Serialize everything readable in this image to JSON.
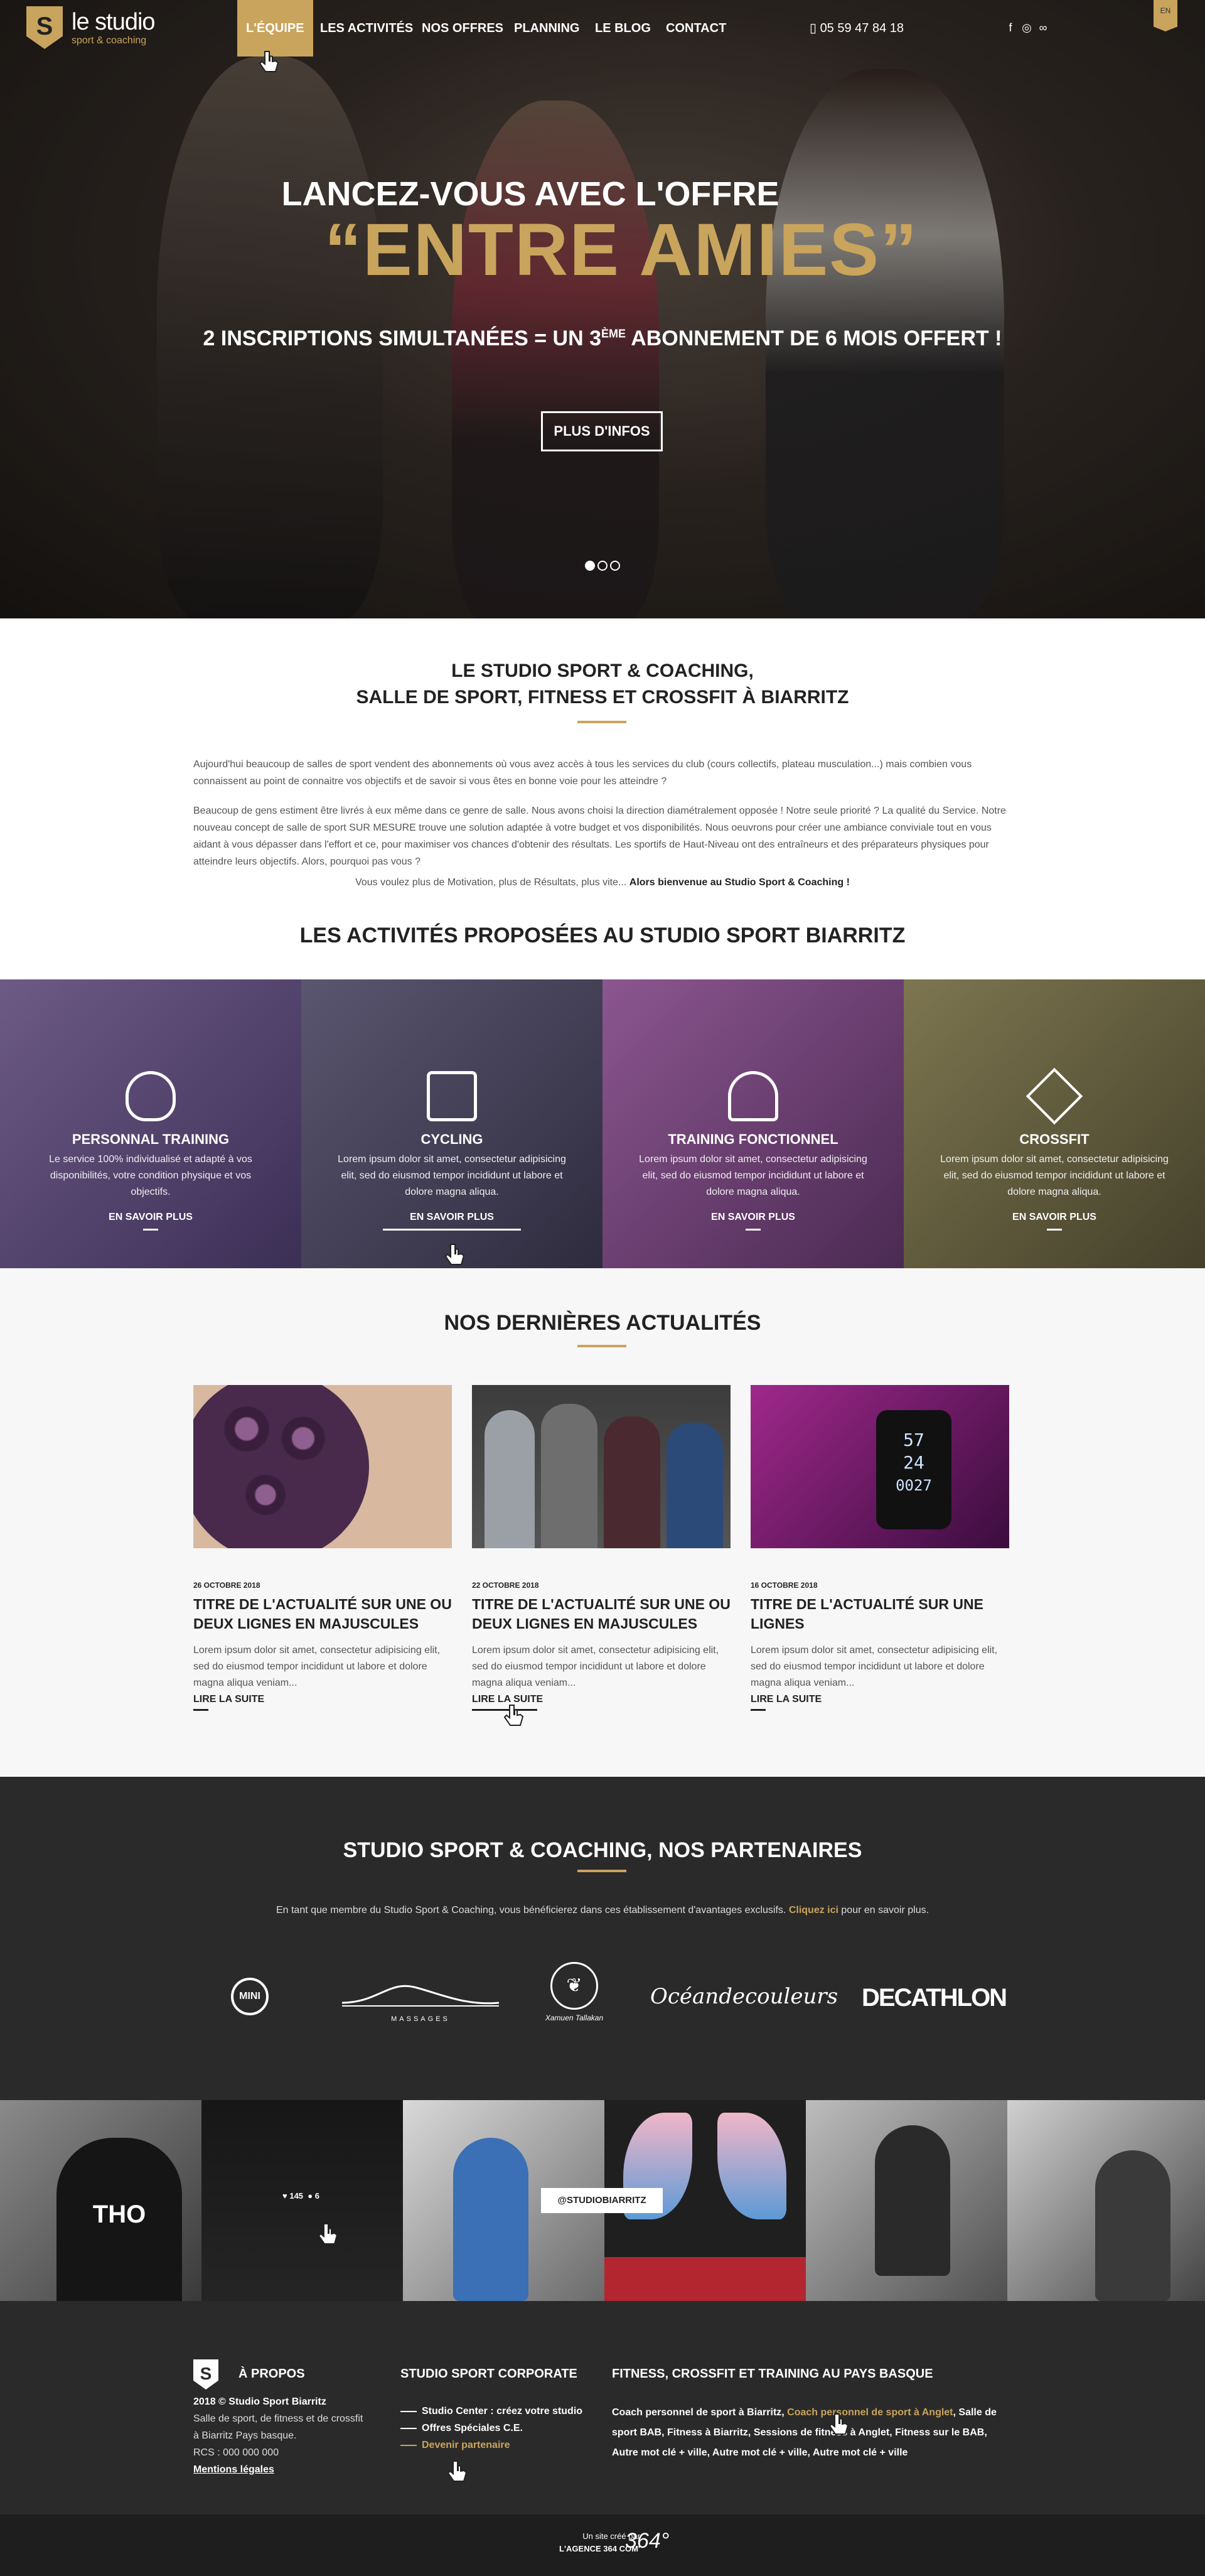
{
  "nav": {
    "logo_main": "le studio",
    "logo_sub": "sport & coaching",
    "items": [
      {
        "label": "L'ÉQUIPE"
      },
      {
        "label": "LES ACTIVITÉS"
      },
      {
        "label": "NOS OFFRES"
      },
      {
        "label": "PLANNING"
      },
      {
        "label": "LE BLOG"
      },
      {
        "label": "CONTACT"
      }
    ],
    "phone": "05 59 47 84 18",
    "lang": "EN",
    "social_icons": [
      "facebook-icon",
      "instagram-icon",
      "tripadvisor-icon"
    ]
  },
  "hero": {
    "line1": "LANCEZ-VOUS AVEC L'OFFRE",
    "line2": "“ENTRE AMIES”",
    "line3_a": "2 INSCRIPTIONS SIMULTANÉES = UN 3",
    "line3_sup": "ÈME",
    "line3_b": " ABONNEMENT DE 6 MOIS OFFERT !",
    "button": "PLUS D'INFOS",
    "slides": 3,
    "active_slide": 1
  },
  "intro": {
    "title1": "LE STUDIO SPORT & COACHING,",
    "title2": "SALLE DE SPORT, FITNESS ET CROSSFIT À BIARRITZ",
    "p1": "Aujourd'hui beaucoup de salles de sport vendent des abonnements où vous avez accès à tous les services du club (cours collectifs, plateau musculation...) mais combien vous connaissent au point de connaitre vos objectifs et de savoir si vous êtes en bonne voie pour les atteindre ?",
    "p2": "Beaucoup de gens estiment être livrés à eux même dans ce genre de salle. Nous avons choisi la direction diamétralement opposée ! Notre seule priorité ? La qualité du Service. Notre nouveau concept de salle de sport SUR MESURE trouve une solution adaptée à votre budget et vos disponibilités. Nous oeuvrons pour créer une ambiance conviviale tout en vous aidant à vous dépasser dans l'effort et ce, pour maximiser vos chances d'obtenir des résultats. Les sportifs de Haut-Niveau ont des entraîneurs et des préparateurs physiques pour atteindre leurs objectifs. Alors, pourquoi pas vous ?",
    "p3_a": "Vous voulez plus de Motivation, plus de Résultats, plus vite... ",
    "p3_b": "Alors bienvenue au Studio Sport & Coaching !"
  },
  "activities": {
    "title": "LES ACTIVITÉS PROPOSÉES AU STUDIO SPORT BIARRITZ",
    "items": [
      {
        "name": "PERSONNAL TRAINING",
        "desc": "Le service 100% individualisé et adapté à vos disponibilités, votre condition physique et vos objectifs.",
        "more": "EN SAVOIR PLUS",
        "icon": "kettlebell-icon",
        "tint": "#4b3d63"
      },
      {
        "name": "CYCLING",
        "desc": "Lorem ipsum dolor sit amet, consectetur adipisicing elit, sed do eiusmod tempor incididunt ut labore et dolore magna aliqua.",
        "more": "EN SAVOIR PLUS",
        "icon": "bike-icon",
        "tint": "#4f4862"
      },
      {
        "name": "TRAINING FONCTIONNEL",
        "desc": "Lorem ipsum dolor sit amet, consectetur adipisicing elit, sed do eiusmod tempor incididunt ut labore et dolore magna aliqua.",
        "more": "EN SAVOIR PLUS",
        "icon": "jump-rope-icon",
        "tint": "#6b3e6c"
      },
      {
        "name": "CROSSFIT",
        "desc": "Lorem ipsum dolor sit amet, consectetur adipisicing elit, sed do eiusmod tempor incididunt ut labore et dolore magna aliqua.",
        "more": "EN SAVOIR PLUS",
        "icon": "dumbbell-icon",
        "tint": "#5e5a3c"
      }
    ]
  },
  "news": {
    "title": "NOS DERNIÈRES ACTUALITÉS",
    "cards": [
      {
        "date": "26 OCTOBRE 2018",
        "title": "TITRE DE L'ACTUALITÉ SUR UNE OU DEUX LIGNES EN MAJUSCULES",
        "text": "Lorem ipsum dolor sit amet, consectetur adipisicing elit, sed do eiusmod tempor incididunt ut labore et dolore magna aliqua veniam...",
        "more": "LIRE LA SUITE"
      },
      {
        "date": "22 OCTOBRE 2018",
        "title": "TITRE DE L'ACTUALITÉ SUR UNE OU DEUX LIGNES EN MAJUSCULES",
        "text": "Lorem ipsum dolor sit amet, consectetur adipisicing elit, sed do eiusmod tempor incididunt ut labore et dolore magna aliqua veniam...",
        "more": "LIRE LA SUITE"
      },
      {
        "date": "16 OCTOBRE 2018",
        "title": "TITRE DE L'ACTUALITÉ SUR UNE LIGNES",
        "text": "Lorem ipsum dolor sit amet, consectetur adipisicing elit, sed do eiusmod tempor incididunt ut labore et dolore magna aliqua veniam...",
        "more": "LIRE LA SUITE"
      }
    ],
    "watch_top": "57",
    "watch_mid": "24",
    "watch_bottom": "0027"
  },
  "partners": {
    "title": "STUDIO SPORT & COACHING, NOS PARTENAIRES",
    "text": "En tant que membre du Studio Sport & Coaching, vous bénéficierez dans ces établissement d'avantages exclusifs. ",
    "link": "Cliquez ici",
    "text_end": " pour en savoir plus.",
    "logos": [
      "MINI",
      "MASSAGES",
      "Xamuen Tallakan",
      "Océandecouleurs",
      "DECATHLON"
    ]
  },
  "instagram": {
    "handle": "@STUDIOBIARRITZ",
    "likes": "145",
    "comments": "6",
    "shirt_text": "THO"
  },
  "footer": {
    "about_title": "À PROPOS",
    "about_bold": "2018 © Studio Sport Biarritz",
    "about_l1": "Salle de sport, de fitness et de crossfit",
    "about_l2": "à Biarritz Pays basque.",
    "about_l3": "RCS : 000 000 000",
    "legal": "Mentions légales",
    "corp_title": "STUDIO SPORT CORPORATE",
    "corp_links": [
      "Studio Center : créez votre studio",
      "Offres Spéciales C.E.",
      "Devenir partenaire"
    ],
    "fit_title": "FITNESS, CROSSFIT ET TRAINING AU PAYS BASQUE",
    "fit_a": "Coach personnel de sport à Biarritz, ",
    "fit_link": "Coach personnel de sport à Anglet",
    "fit_b": ", Salle de sport BAB, Fitness à Biarritz, Sessions de fitness à Anglet, Fitness sur le BAB, Autre mot clé + ville, Autre mot clé + ville, Autre mot clé + ville",
    "credit_1": "Un site créé par",
    "credit_2": "L'AGENCE 364 COM'",
    "agency_logo": "364°"
  },
  "colors": {
    "accent": "#c9a45c",
    "dark": "#2a2a2a",
    "news_bg": "#f7f7f7"
  }
}
